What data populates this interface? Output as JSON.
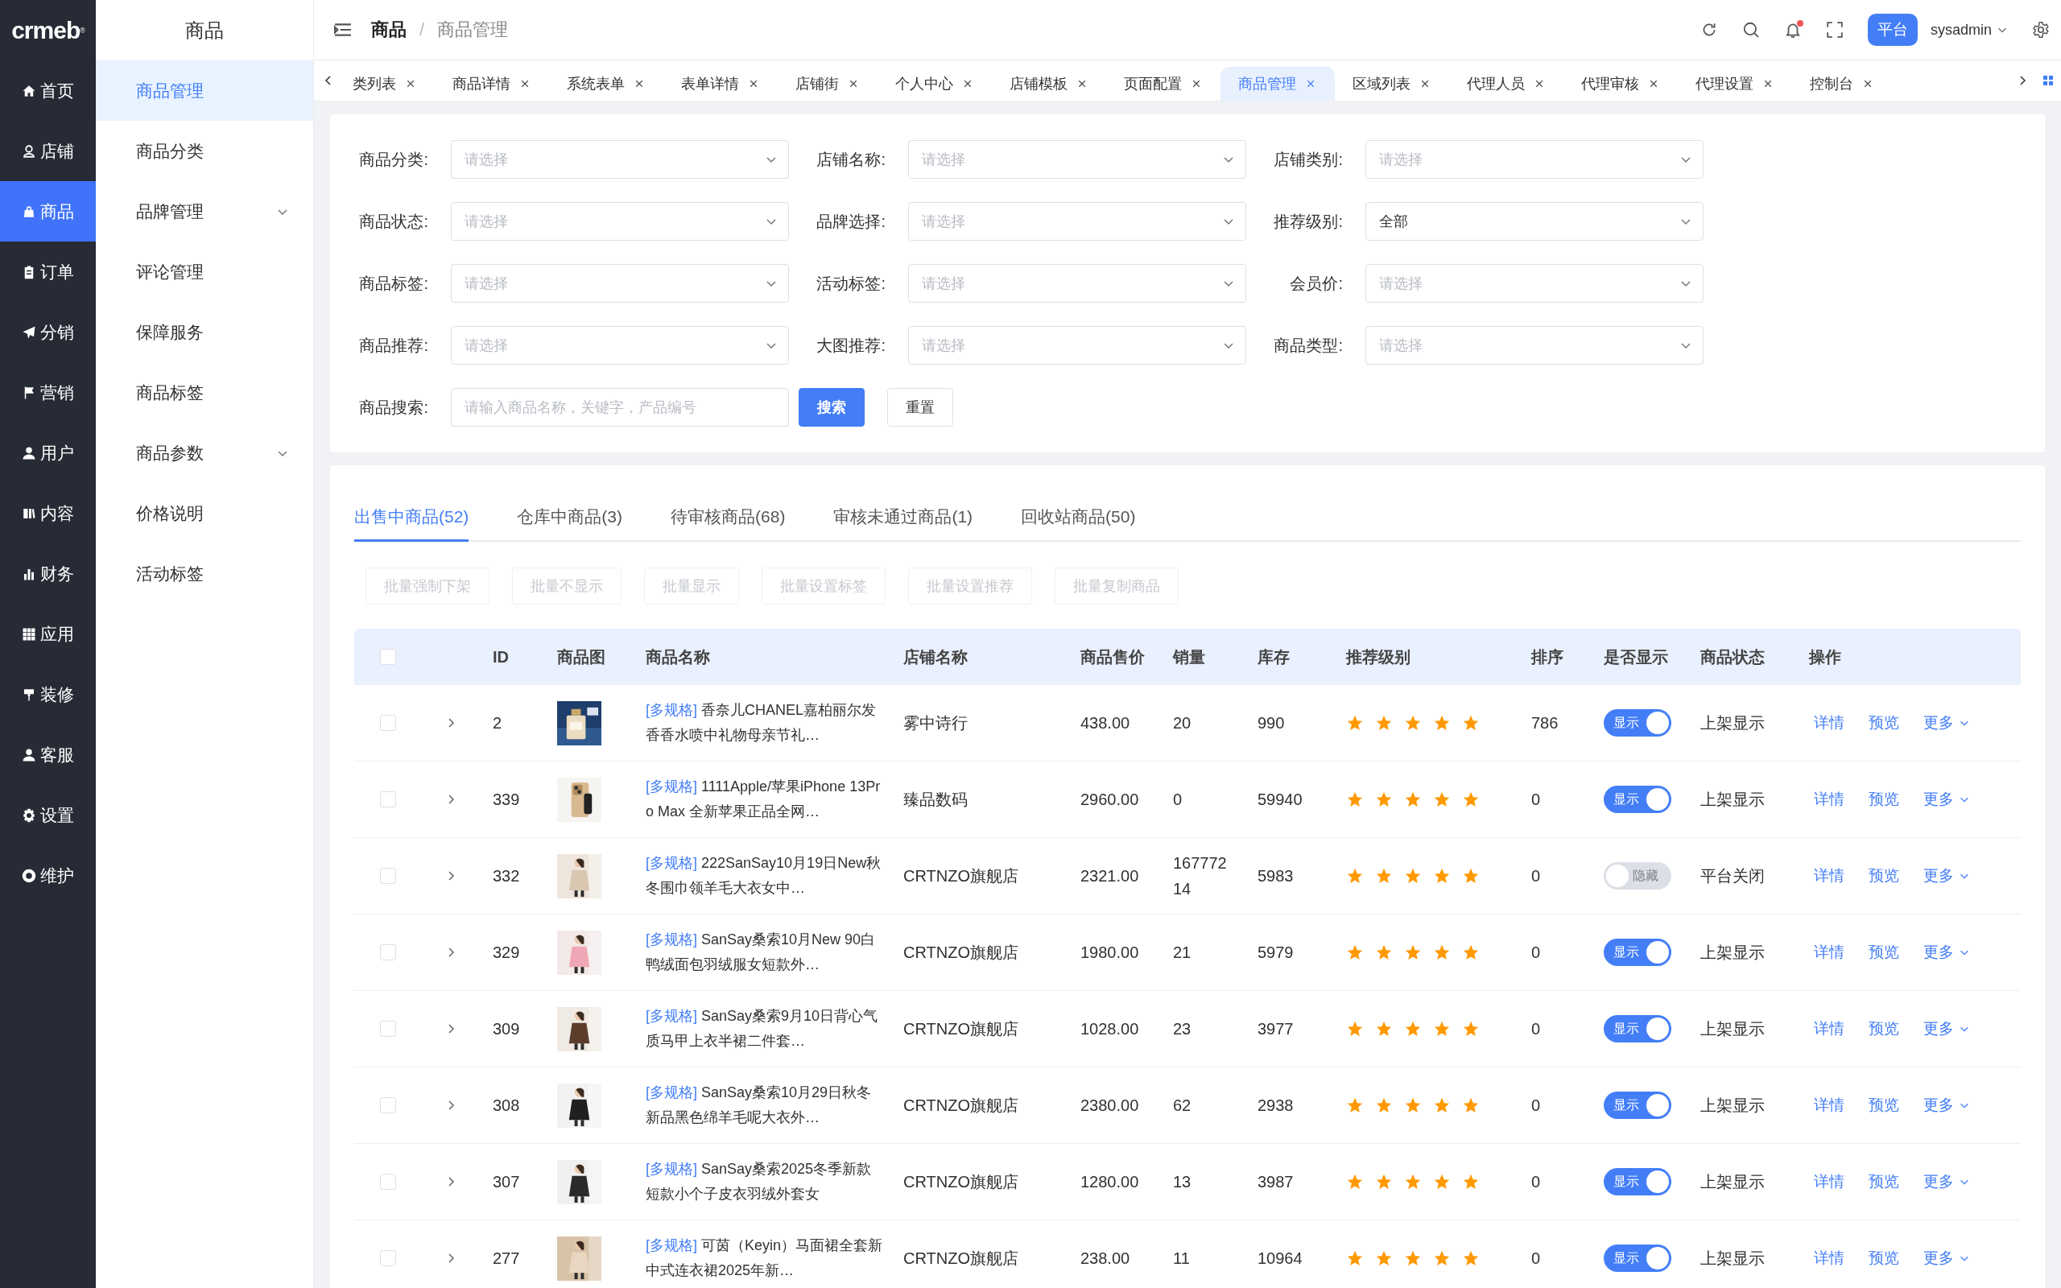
{
  "logo": "crmeb$^{®}$",
  "nav": [
    {
      "label": "首页",
      "selected": false
    },
    {
      "label": "店铺",
      "selected": false
    },
    {
      "label": "商品",
      "selected": true
    },
    {
      "label": "订单",
      "selected": false
    },
    {
      "label": "分销",
      "selected": false
    },
    {
      "label": "营销",
      "selected": false
    },
    {
      "label": "用户",
      "selected": false
    },
    {
      "label": "内容",
      "selected": false
    },
    {
      "label": "财务",
      "selected": false
    },
    {
      "label": "应用",
      "selected": false
    },
    {
      "label": "装修",
      "selected": false
    },
    {
      "label": "客服",
      "selected": false
    },
    {
      "label": "设置",
      "selected": false
    },
    {
      "label": "维护",
      "selected": false
    }
  ],
  "subnav": {
    "title": "商品",
    "items": [
      {
        "label": "商品管理",
        "kind": "link",
        "selected": true
      },
      {
        "label": "商品分类",
        "kind": "link",
        "selected": false
      },
      {
        "label": "品牌管理",
        "kind": "group",
        "selected": false
      },
      {
        "label": "评论管理",
        "kind": "link",
        "selected": false
      },
      {
        "label": "保障服务",
        "kind": "link",
        "selected": false
      },
      {
        "label": "商品标签",
        "kind": "link",
        "selected": false
      },
      {
        "label": "商品参数",
        "kind": "group",
        "selected": false
      },
      {
        "label": "价格说明",
        "kind": "link",
        "selected": false
      },
      {
        "label": "活动标签",
        "kind": "link",
        "selected": false
      }
    ]
  },
  "header": {
    "breadcrumb": [
      "商品",
      "商品管理"
    ],
    "separator": "/",
    "notification": true,
    "role": "平台",
    "user": "sysadmin"
  },
  "page_tabs": [
    {
      "label": "类列表",
      "selected": false
    },
    {
      "label": "商品详情",
      "selected": false
    },
    {
      "label": "系统表单",
      "selected": false
    },
    {
      "label": "表单详情",
      "selected": false
    },
    {
      "label": "店铺街",
      "selected": false
    },
    {
      "label": "个人中心",
      "selected": false
    },
    {
      "label": "店铺模板",
      "selected": false
    },
    {
      "label": "页面配置",
      "selected": false
    },
    {
      "label": "商品管理",
      "selected": true
    },
    {
      "label": "区域列表",
      "selected": false
    },
    {
      "label": "代理人员",
      "selected": false
    },
    {
      "label": "代理审核",
      "selected": false
    },
    {
      "label": "代理设置",
      "selected": false
    },
    {
      "label": "控制台",
      "selected": false
    }
  ],
  "filters": [
    {
      "label": "商品分类:",
      "placeholder": "请选择"
    },
    {
      "label": "店铺名称:",
      "placeholder": "请选择"
    },
    {
      "label": "店铺类别:",
      "placeholder": "请选择"
    },
    {
      "label": "商品状态:",
      "placeholder": "请选择"
    },
    {
      "label": "品牌选择:",
      "placeholder": "请选择"
    },
    {
      "label": "推荐级别:",
      "value": "全部"
    },
    {
      "label": "商品标签:",
      "placeholder": "请选择"
    },
    {
      "label": "活动标签:",
      "placeholder": "请选择"
    },
    {
      "label": "会员价:",
      "placeholder": "请选择"
    },
    {
      "label": "商品推荐:",
      "placeholder": "请选择"
    },
    {
      "label": "大图推荐:",
      "placeholder": "请选择"
    },
    {
      "label": "商品类型:",
      "placeholder": "请选择"
    }
  ],
  "search": {
    "label": "商品搜索:",
    "placeholder": "请输入商品名称，关键字，产品编号",
    "buttons": [
      {
        "label": "搜索",
        "kind": "primary"
      },
      {
        "label": "重置",
        "kind": "default"
      }
    ]
  },
  "status_tabs": [
    {
      "label": "出售中商品(52)",
      "selected": true
    },
    {
      "label": "仓库中商品(3)",
      "selected": false
    },
    {
      "label": "待审核商品(68)",
      "selected": false
    },
    {
      "label": "审核未通过商品(1)",
      "selected": false
    },
    {
      "label": "回收站商品(50)",
      "selected": false
    }
  ],
  "batch_actions": [
    {
      "label": "批量强制下架",
      "disabled": true
    },
    {
      "label": "批量不显示",
      "disabled": true
    },
    {
      "label": "批量显示",
      "disabled": true
    },
    {
      "label": "批量设置标签",
      "disabled": true
    },
    {
      "label": "批量设置推荐",
      "disabled": true
    },
    {
      "label": "批量复制商品",
      "disabled": true
    }
  ],
  "table": {
    "header_checked": false,
    "columns": [
      "ID",
      "商品图",
      "商品名称",
      "店铺名称",
      "商品售价",
      "销量",
      "库存",
      "推荐级别",
      "排序",
      "是否显示",
      "商品状态",
      "操作"
    ],
    "rows": [
      {
        "checked": false,
        "expanded": false,
        "id": "2",
        "tag": "[多规格]",
        "name": "香奈儿CHANEL嘉柏丽尔发香香水喷中礼物母亲节礼…",
        "shop": "雾中诗行",
        "price": "438.00",
        "sales": "20",
        "stock": "990",
        "stars": 5,
        "sort": "786",
        "display": {
          "on": true,
          "label": "显示"
        },
        "status": "上架显示",
        "actions": [
          "详情",
          "预览",
          "更多"
        ]
      },
      {
        "checked": false,
        "expanded": false,
        "id": "339",
        "tag": "[多规格]",
        "name": "1111Apple/苹果iPhone 13Pro Max 全新苹果正品全网…",
        "shop": "臻品数码",
        "price": "2960.00",
        "sales": "0",
        "stock": "59940",
        "stars": 5,
        "sort": "0",
        "display": {
          "on": true,
          "label": "显示"
        },
        "status": "上架显示",
        "actions": [
          "详情",
          "预览",
          "更多"
        ]
      },
      {
        "checked": false,
        "expanded": false,
        "id": "332",
        "tag": "[多规格]",
        "name": "222SanSay10月19日New秋冬围巾领羊毛大衣女中…",
        "shop": "CRTNZO旗舰店",
        "price": "2321.00",
        "sales": "16777214",
        "stock": "5983",
        "stars": 5,
        "sort": "0",
        "display": {
          "on": false,
          "label": "隐藏"
        },
        "status": "平台关闭",
        "actions": [
          "详情",
          "预览",
          "更多"
        ]
      },
      {
        "checked": false,
        "expanded": false,
        "id": "329",
        "tag": "[多规格]",
        "name": "SanSay桑索10月New 90白鸭绒面包羽绒服女短款外…",
        "shop": "CRTNZO旗舰店",
        "price": "1980.00",
        "sales": "21",
        "stock": "5979",
        "stars": 5,
        "sort": "0",
        "display": {
          "on": true,
          "label": "显示"
        },
        "status": "上架显示",
        "actions": [
          "详情",
          "预览",
          "更多"
        ]
      },
      {
        "checked": false,
        "expanded": false,
        "id": "309",
        "tag": "[多规格]",
        "name": "SanSay桑索9月10日背心气质马甲上衣半裙二件套…",
        "shop": "CRTNZO旗舰店",
        "price": "1028.00",
        "sales": "23",
        "stock": "3977",
        "stars": 5,
        "sort": "0",
        "display": {
          "on": true,
          "label": "显示"
        },
        "status": "上架显示",
        "actions": [
          "详情",
          "预览",
          "更多"
        ]
      },
      {
        "checked": false,
        "expanded": false,
        "id": "308",
        "tag": "[多规格]",
        "name": "SanSay桑索10月29日秋冬新品黑色绵羊毛呢大衣外…",
        "shop": "CRTNZO旗舰店",
        "price": "2380.00",
        "sales": "62",
        "stock": "2938",
        "stars": 5,
        "sort": "0",
        "display": {
          "on": true,
          "label": "显示"
        },
        "status": "上架显示",
        "actions": [
          "详情",
          "预览",
          "更多"
        ]
      },
      {
        "checked": false,
        "expanded": false,
        "id": "307",
        "tag": "[多规格]",
        "name": "SanSay桑索2025冬季新款短款小个子皮衣羽绒外套女",
        "shop": "CRTNZO旗舰店",
        "price": "1280.00",
        "sales": "13",
        "stock": "3987",
        "stars": 5,
        "sort": "0",
        "display": {
          "on": true,
          "label": "显示"
        },
        "status": "上架显示",
        "actions": [
          "详情",
          "预览",
          "更多"
        ]
      },
      {
        "checked": false,
        "expanded": false,
        "id": "277",
        "tag": "[多规格]",
        "name": "可茵（Keyin）马面裙全套新中式连衣裙2025年新…",
        "shop": "CRTNZO旗舰店",
        "price": "238.00",
        "sales": "11",
        "stock": "10964",
        "stars": 5,
        "sort": "0",
        "display": {
          "on": true,
          "label": "显示"
        },
        "status": "上架显示",
        "actions": [
          "详情",
          "预览",
          "更多"
        ]
      }
    ]
  }
}
